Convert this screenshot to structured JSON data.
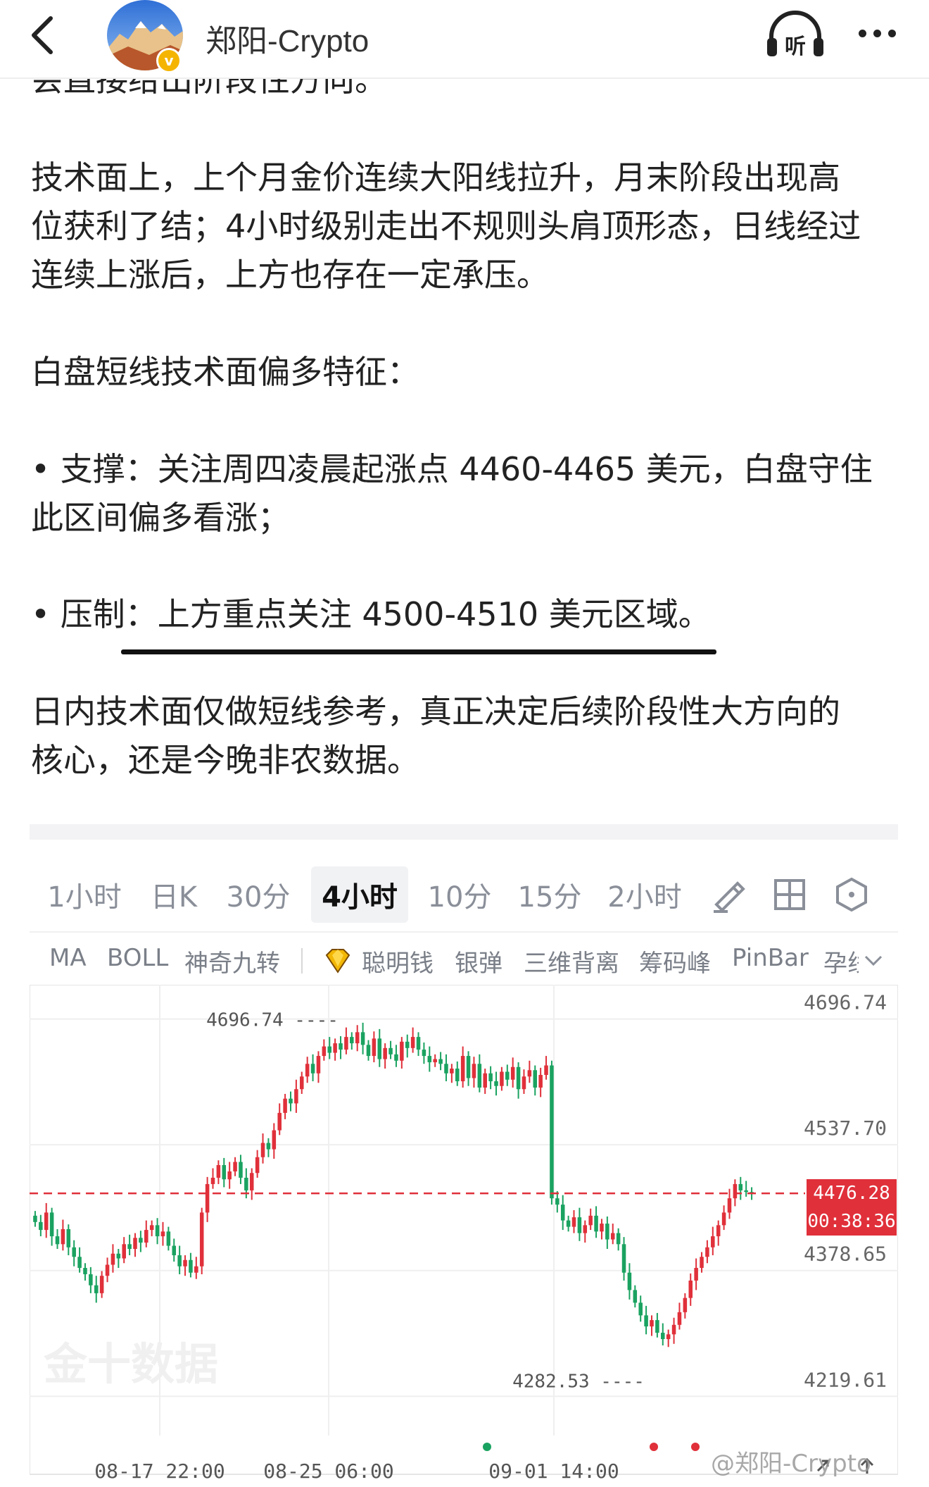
{
  "nav": {
    "author_name": "郑阳-Crypto",
    "listen_label": "听",
    "verified_badge": "v"
  },
  "article": {
    "cut_line": "会直接给出阶段性方向。",
    "paragraphs": [
      [
        "技术面上，上个月金价连续大阳线拉升，月末阶段出现高",
        "位获利了结；4小时级别走出不规则头肩顶形态，日线经过",
        "连续上涨后，上方也存在一定承压。"
      ],
      [
        "白盘短线技术面偏多特征："
      ],
      [
        "• 支撑：关注周四凌晨起涨点 4460-4465 美元，白盘守住",
        "此区间偏多看涨；"
      ],
      [
        "• 压制：上方重点关注 4500-4510 美元区域。"
      ],
      [
        "日内技术面仅做短线参考，真正决定后续阶段性大方向的",
        "核心，还是今晚非农数据。"
      ]
    ]
  },
  "chart_widget": {
    "period_tabs": [
      {
        "label": "1小时",
        "active": false
      },
      {
        "label": "日K",
        "active": false
      },
      {
        "label": "30分",
        "active": false
      },
      {
        "label": "4小时",
        "active": true
      },
      {
        "label": "10分",
        "active": false
      },
      {
        "label": "15分",
        "active": false
      },
      {
        "label": "2小时",
        "active": false
      }
    ],
    "tool_icons": [
      "draw-pen-icon",
      "layout-grid-icon",
      "settings-hexagon-icon"
    ],
    "indicators": [
      "MA",
      "BOLL",
      "神奇九转",
      "聪明钱",
      "银弹",
      "三维背离",
      "筹码峰",
      "PinBar",
      "孕线"
    ],
    "premium_icon": "diamond-icon",
    "expand_icon": "chevron-down-icon",
    "watermark": "金十数据",
    "current_price": "4476.28",
    "countdown": "00:38:36",
    "high_label": "4696.74",
    "low_label": "4282.53",
    "corner_icons": [
      "arrow-diagonal-icon",
      "arrow-up-icon"
    ],
    "colors": {
      "up": "#e0303a",
      "down": "#1aa260",
      "grid": "#efefef",
      "price_line": "#e0303a"
    }
  },
  "image_watermark": "@郑阳-Crypto",
  "chart_data": {
    "type": "candlestick",
    "y_ticks": [
      "4696.74",
      "4537.70",
      "4378.65",
      "4219.61"
    ],
    "ylim": [
      4170,
      4740
    ],
    "x_ticks": [
      "08-17 22:00",
      "08-25 06:00",
      "09-01 14:00"
    ],
    "current_price": 4476.28,
    "high": 4696.74,
    "low": 4282.53,
    "close_series": [
      4440,
      4430,
      4452,
      4422,
      4412,
      4431,
      4408,
      4396,
      4382,
      4374,
      4360,
      4350,
      4372,
      4386,
      4400,
      4394,
      4412,
      4406,
      4420,
      4414,
      4430,
      4436,
      4422,
      4428,
      4410,
      4398,
      4384,
      4392,
      4376,
      4384,
      4452,
      4488,
      4496,
      4512,
      4494,
      4504,
      4516,
      4496,
      4480,
      4502,
      4522,
      4540,
      4532,
      4556,
      4578,
      4596,
      4590,
      4608,
      4624,
      4640,
      4628,
      4650,
      4662,
      4654,
      4666,
      4658,
      4674,
      4666,
      4680,
      4664,
      4650,
      4672,
      4646,
      4660,
      4652,
      4644,
      4668,
      4660,
      4674,
      4658,
      4650,
      4642,
      4646,
      4640,
      4628,
      4634,
      4618,
      4650,
      4622,
      4640,
      4610,
      4628,
      4618,
      4612,
      4630,
      4620,
      4636,
      4608,
      4624,
      4632,
      4610,
      4626,
      4638,
      4470,
      4462,
      4442,
      4434,
      4446,
      4426,
      4436,
      4448,
      4428,
      4438,
      4418,
      4426,
      4412,
      4376,
      4354,
      4338,
      4322,
      4308,
      4316,
      4300,
      4292,
      4298,
      4310,
      4326,
      4344,
      4366,
      4382,
      4396,
      4408,
      4422,
      4436,
      4452,
      4470,
      4488,
      4480,
      4478,
      4476
    ]
  }
}
